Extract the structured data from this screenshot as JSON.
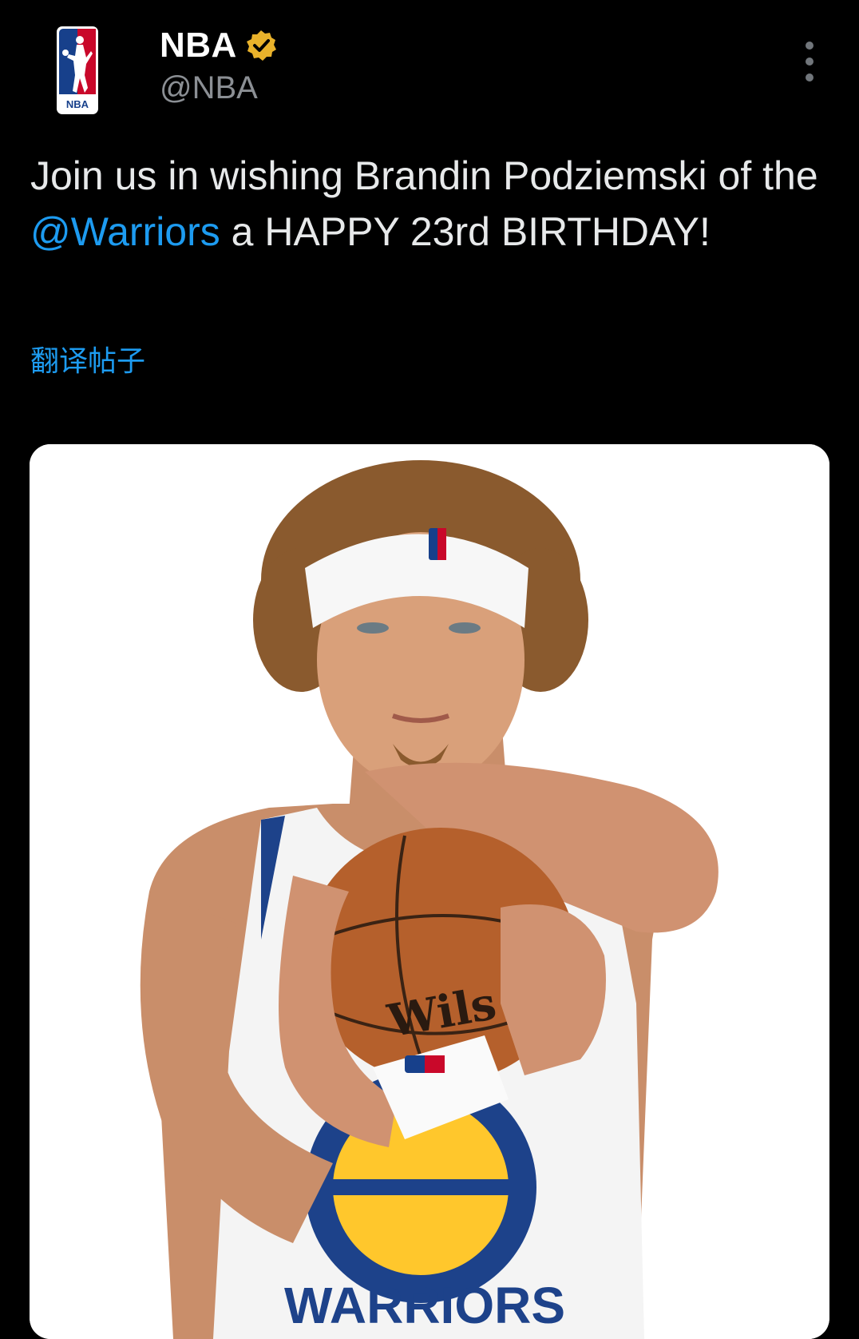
{
  "account": {
    "display_name": "NBA",
    "handle": "@NBA",
    "verified": true,
    "logo_text": "NBA",
    "badge_color": "#e9b22b"
  },
  "tweet": {
    "text_before": "Join us in wishing Brandin Podziemski of the ",
    "mention": "@Warriors",
    "text_after": " a HAPPY 23rd BIRTHDAY!",
    "translate_label": "翻译帖子"
  },
  "media": {
    "jersey_text": "WARRIORS",
    "ball_brand": "Wils"
  },
  "icons": {
    "logo": "nba-logo-icon",
    "badge": "verified-badge-icon",
    "more": "more-vertical-icon"
  },
  "colors": {
    "background": "#000000",
    "text": "#e7e9ea",
    "link": "#1d9bf0",
    "muted": "#8b8f94"
  }
}
